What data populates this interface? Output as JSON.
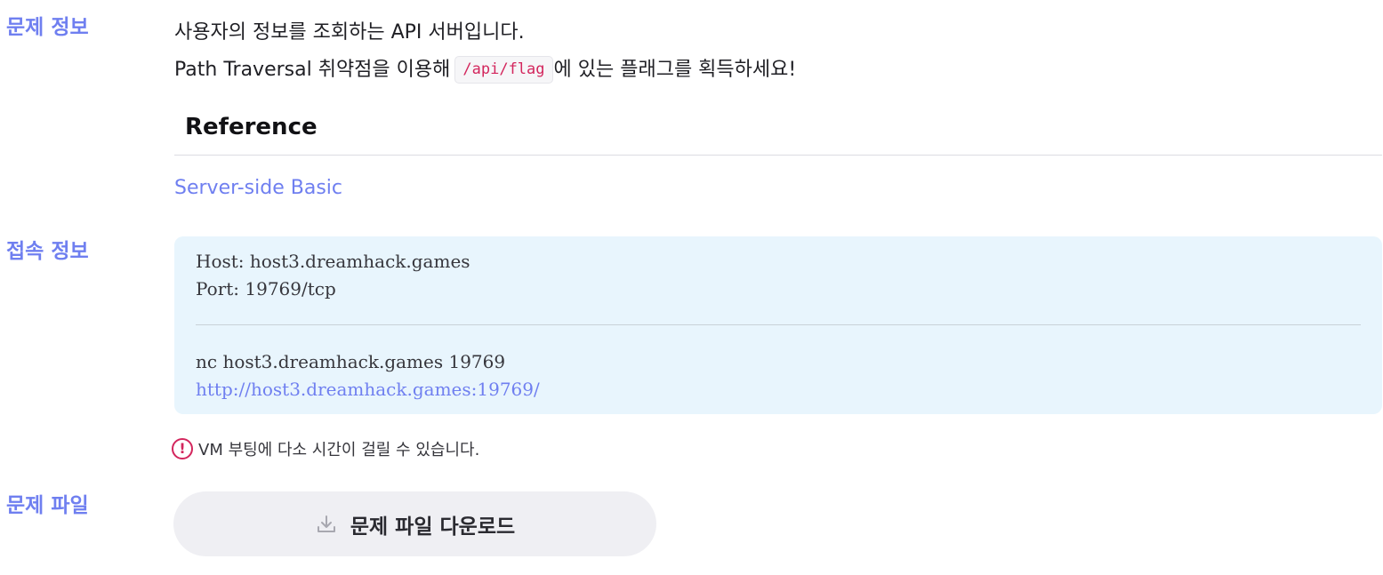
{
  "labels": {
    "problem_info": "문제 정보",
    "connection_info": "접속 정보",
    "problem_file": "문제 파일"
  },
  "description": {
    "line1": "사용자의 정보를 조회하는 API 서버입니다.",
    "line2_before": "Path Traversal 취약점을 이용해",
    "line2_code": "/api/flag",
    "line2_after": "에 있는 플래그를 획득하세요!"
  },
  "reference": {
    "heading": "Reference",
    "link": "Server-side Basic"
  },
  "connection": {
    "host": "Host: host3.dreamhack.games",
    "port": "Port: 19769/tcp",
    "nc_command": "nc host3.dreamhack.games 19769",
    "url": "http://host3.dreamhack.games:19769/"
  },
  "notice": {
    "icon": "alert-circle-icon",
    "text": "VM 부팅에 다소 시간이 걸릴 수 있습니다."
  },
  "download": {
    "icon": "download-icon",
    "label": "문제 파일 다운로드"
  },
  "colors": {
    "accent": "#6f7ff0",
    "code_text": "#d3265d",
    "info_box_bg": "#e8f5fd",
    "button_bg": "#efeff3"
  }
}
